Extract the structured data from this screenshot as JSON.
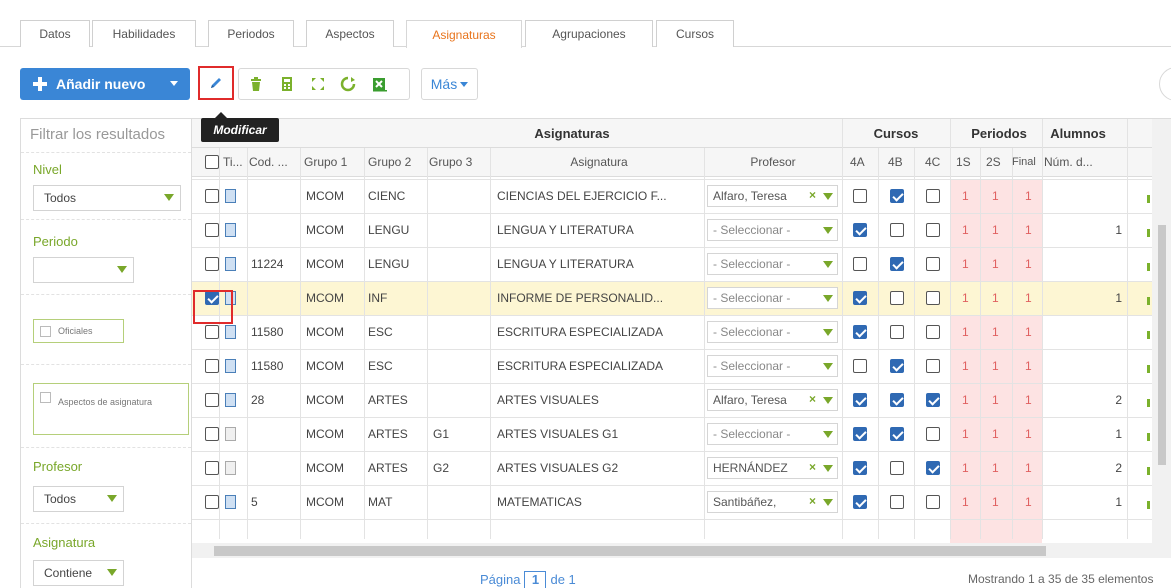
{
  "tabs": [
    {
      "label": "Datos"
    },
    {
      "label": "Habilidades"
    },
    {
      "label": "Periodos"
    },
    {
      "label": "Aspectos"
    },
    {
      "label": "Asignaturas",
      "active": true
    },
    {
      "label": "Agrupaciones"
    },
    {
      "label": "Cursos"
    }
  ],
  "toolbar": {
    "add_label": "Añadir nuevo",
    "more_label": "Más",
    "tooltip": "Modificar"
  },
  "sidebar": {
    "filter_placeholder": "Filtrar los resultados",
    "nivel_label": "Nivel",
    "nivel_value": "Todos",
    "periodo_label": "Periodo",
    "periodo_value": "",
    "oficiales_label": "Oficiales",
    "aspectos_label": "Aspectos de asignatura",
    "profesor_label": "Profesor",
    "profesor_value": "Todos",
    "asignatura_label": "Asignatura",
    "asignatura_value": "Contiene"
  },
  "grid": {
    "groups": {
      "asignaturas": "Asignaturas",
      "cursos": "Cursos",
      "periodos": "Periodos",
      "alumnos": "Alumnos"
    },
    "columns": {
      "tipo": "Ti...",
      "cod": "Cod. ...",
      "grupo1": "Grupo 1",
      "grupo2": "Grupo 2",
      "grupo3": "Grupo 3",
      "asignatura": "Asignatura",
      "profesor": "Profesor",
      "c4a": "4A",
      "c4b": "4B",
      "c4c": "4C",
      "p1s": "1S",
      "p2s": "2S",
      "pfinal": "Final",
      "num": "Núm. d..."
    },
    "rows": [
      {
        "selected": false,
        "doc": "blue",
        "cod": "",
        "g1": "MCOM",
        "g2": "CIENC",
        "g3": "",
        "asig": "CIENCIAS DEL EJERCICIO F...",
        "prof": "Alfaro, Teresa",
        "prof_clear": true,
        "c4a": false,
        "c4b": true,
        "c4c": false,
        "p1s": "1",
        "p2s": "1",
        "pf": "1",
        "num": ""
      },
      {
        "selected": false,
        "doc": "blue",
        "cod": "",
        "g1": "MCOM",
        "g2": "LENGU",
        "g3": "",
        "asig": "LENGUA Y LITERATURA",
        "prof": "- Seleccionar -",
        "prof_clear": false,
        "c4a": true,
        "c4b": false,
        "c4c": false,
        "p1s": "1",
        "p2s": "1",
        "pf": "1",
        "num": "1"
      },
      {
        "selected": false,
        "doc": "blue",
        "cod": "11224",
        "g1": "MCOM",
        "g2": "LENGU",
        "g3": "",
        "asig": "LENGUA Y LITERATURA",
        "prof": "- Seleccionar -",
        "prof_clear": false,
        "c4a": false,
        "c4b": true,
        "c4c": false,
        "p1s": "1",
        "p2s": "1",
        "pf": "1",
        "num": ""
      },
      {
        "selected": true,
        "doc": "blue",
        "cod": "",
        "g1": "MCOM",
        "g2": "INF",
        "g3": "",
        "asig": "INFORME DE PERSONALID...",
        "prof": "- Seleccionar -",
        "prof_clear": false,
        "c4a": true,
        "c4b": false,
        "c4c": false,
        "p1s": "1",
        "p2s": "1",
        "pf": "1",
        "num": "1"
      },
      {
        "selected": false,
        "doc": "blue",
        "cod": "11580",
        "g1": "MCOM",
        "g2": "ESC",
        "g3": "",
        "asig": "ESCRITURA ESPECIALIZADA",
        "prof": "- Seleccionar -",
        "prof_clear": false,
        "c4a": true,
        "c4b": false,
        "c4c": false,
        "p1s": "1",
        "p2s": "1",
        "pf": "1",
        "num": ""
      },
      {
        "selected": false,
        "doc": "blue",
        "cod": "11580",
        "g1": "MCOM",
        "g2": "ESC",
        "g3": "",
        "asig": "ESCRITURA ESPECIALIZADA",
        "prof": "- Seleccionar -",
        "prof_clear": false,
        "c4a": false,
        "c4b": true,
        "c4c": false,
        "p1s": "1",
        "p2s": "1",
        "pf": "1",
        "num": ""
      },
      {
        "selected": false,
        "doc": "blue",
        "cod": "28",
        "g1": "MCOM",
        "g2": "ARTES",
        "g3": "",
        "asig": "ARTES VISUALES",
        "prof": "Alfaro, Teresa",
        "prof_clear": true,
        "c4a": true,
        "c4b": true,
        "c4c": true,
        "p1s": "1",
        "p2s": "1",
        "pf": "1",
        "num": "2"
      },
      {
        "selected": false,
        "doc": "grey",
        "cod": "",
        "g1": "MCOM",
        "g2": "ARTES",
        "g3": "G1",
        "asig": "ARTES VISUALES G1",
        "prof": "- Seleccionar -",
        "prof_clear": false,
        "c4a": true,
        "c4b": true,
        "c4c": false,
        "p1s": "1",
        "p2s": "1",
        "pf": "1",
        "num": "1"
      },
      {
        "selected": false,
        "doc": "grey",
        "cod": "",
        "g1": "MCOM",
        "g2": "ARTES",
        "g3": "G2",
        "asig": "ARTES VISUALES G2",
        "prof": "HERNÁNDEZ",
        "prof_clear": true,
        "c4a": true,
        "c4b": false,
        "c4c": true,
        "p1s": "1",
        "p2s": "1",
        "pf": "1",
        "num": "2"
      },
      {
        "selected": false,
        "doc": "blue",
        "cod": "5",
        "g1": "MCOM",
        "g2": "MAT",
        "g3": "",
        "asig": "MATEMATICAS",
        "prof": "Santibáñez,",
        "prof_clear": true,
        "c4a": true,
        "c4b": false,
        "c4c": false,
        "p1s": "1",
        "p2s": "1",
        "pf": "1",
        "num": "1"
      }
    ]
  },
  "footer": {
    "page_label": "Página",
    "page_value": "1",
    "of_label": "de 1",
    "count_text": "Mostrando 1 a 35 de 35 elementos"
  },
  "colors": {
    "accent_blue": "#3a86d6",
    "active_tab": "#e8741c",
    "green": "#79a72a",
    "highlight_red": "#e02b2b",
    "selected_row": "#fdf6d3",
    "periodo_bg": "#fde3e3"
  }
}
